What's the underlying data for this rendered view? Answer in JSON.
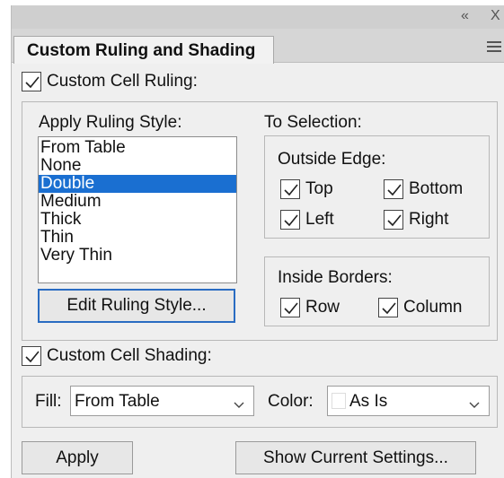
{
  "panel": {
    "tab_title": "Custom Ruling and Shading",
    "collapse_glyph": "«",
    "close_glyph": "X"
  },
  "ruling": {
    "label": "Custom Cell Ruling:",
    "checked": true,
    "apply_style_label": "Apply Ruling Style:",
    "styles": [
      "From Table",
      "None",
      "Double",
      "Medium",
      "Thick",
      "Thin",
      "Very Thin"
    ],
    "selected_style": "Double",
    "edit_button": "Edit Ruling Style..."
  },
  "selection": {
    "label": "To Selection:",
    "outside_edge": {
      "label": "Outside Edge:",
      "top": "Top",
      "bottom": "Bottom",
      "left": "Left",
      "right": "Right"
    },
    "inside_borders": {
      "label": "Inside Borders:",
      "row": "Row",
      "column": "Column"
    }
  },
  "shading": {
    "label": "Custom Cell Shading:",
    "checked": true,
    "fill_label": "Fill:",
    "fill_value": "From Table",
    "color_label": "Color:",
    "color_value": "As Is",
    "swatch_color": "#ffffff"
  },
  "footer": {
    "apply_button": "Apply",
    "show_settings_button": "Show Current Settings..."
  },
  "colors": {
    "selection": "#1a6fd1",
    "panel_bg": "#efefef",
    "focus_border": "#2a6cc2"
  }
}
